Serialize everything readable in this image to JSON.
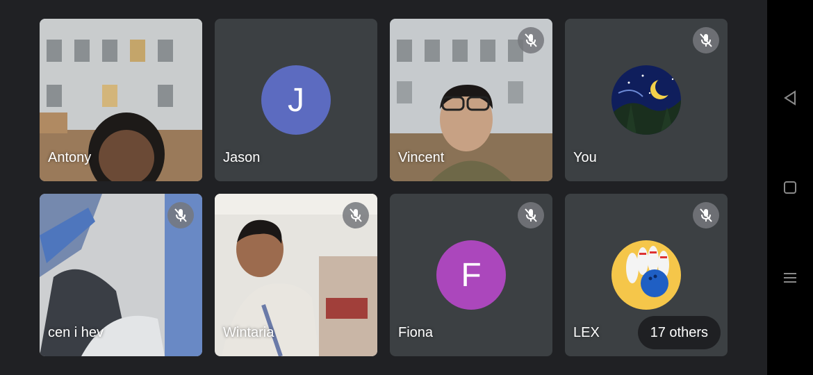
{
  "participants": [
    {
      "name": "Antony",
      "muted": false,
      "type": "video"
    },
    {
      "name": "Jason",
      "muted": false,
      "type": "letter",
      "letter": "J",
      "color": "#5c6bc0"
    },
    {
      "name": "Vincent",
      "muted": true,
      "type": "video"
    },
    {
      "name": "You",
      "muted": true,
      "type": "image",
      "image": "night-sky-moon-avatar"
    },
    {
      "name": "cen i hev",
      "muted": true,
      "type": "video"
    },
    {
      "name": "Wintaria",
      "muted": true,
      "type": "video"
    },
    {
      "name": "Fiona",
      "muted": true,
      "type": "letter",
      "letter": "F",
      "color": "#ab47bc"
    },
    {
      "name": "LEX",
      "muted": true,
      "type": "image",
      "image": "bowling-avatar"
    }
  ],
  "others_label": "17 others",
  "nav": {
    "back_icon": "back-triangle-icon",
    "home_icon": "home-square-icon",
    "recents_icon": "recents-lines-icon"
  },
  "colors": {
    "background": "#202124",
    "tile": "#3c4043",
    "jason_avatar": "#5c6bc0",
    "fiona_avatar": "#ab47bc"
  }
}
